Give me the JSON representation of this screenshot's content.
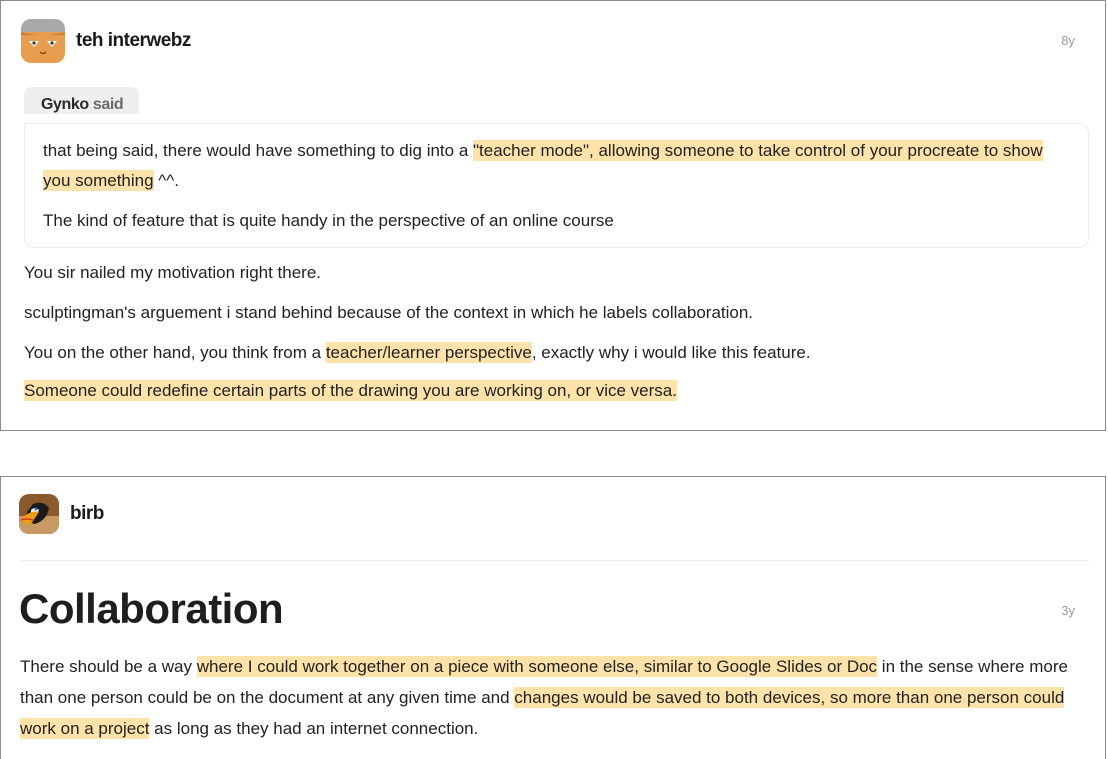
{
  "posts": [
    {
      "author": "teh interwebz",
      "timestamp": "8y",
      "avatar_icon": "cat-face-avatar",
      "quote": {
        "user": "Gynko",
        "said": "said",
        "line1_pre": "that being said, there would have something to dig into a ",
        "line1_highlight": "\"teacher mode\", allowing someone to take control of your procreate to show you something",
        "line1_post": " ^^.",
        "line2": "The kind of feature that is quite handy in the perspective of an online course"
      },
      "paragraphs": {
        "p1": "You sir nailed my motivation right there.",
        "p2": "sculptingman's arguement i stand behind because of the context in which he labels collaboration.",
        "p3_pre": "You on the other hand, you think from a ",
        "p3_highlight": "teacher/learner perspective",
        "p3_post": ", exactly why i would like this feature.",
        "p4_highlight": "Someone could redefine certain parts of the drawing you are working on, or vice versa."
      }
    },
    {
      "author": "birb",
      "timestamp": "3y",
      "avatar_icon": "toucan-avatar",
      "title": "Collaboration",
      "body": {
        "s1": "There should be a way ",
        "h1": "where I could work together on a piece with someone else, similar to Google Slides or Doc",
        "s2": " in the sense where more than one person could be on the document at any given  time and ",
        "h2": "changes would be saved to both devices, so more than one person could work on a project",
        "s3": " as long as they had an internet connection."
      }
    }
  ],
  "colors": {
    "highlight": "#fde2aa",
    "border": "#8c8c8c",
    "quote_tab_bg": "#efefef",
    "timestamp": "#9a9a9a"
  }
}
